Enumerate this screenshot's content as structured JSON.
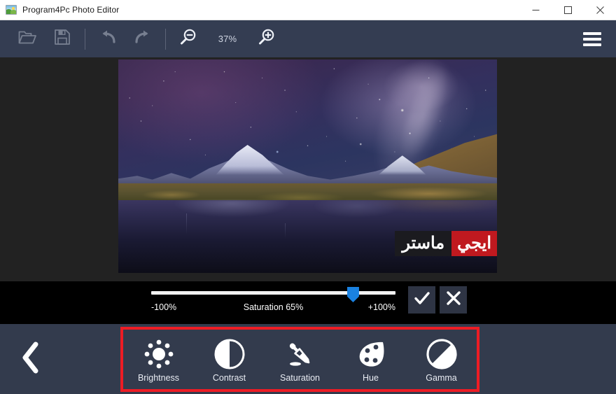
{
  "window": {
    "title": "Program4Pc Photo Editor",
    "app_icon": "photo-icon",
    "minimize": "–",
    "maximize": "☐",
    "close": "×"
  },
  "toolbar": {
    "open_label": "open-file",
    "save_label": "save-file",
    "undo_label": "undo",
    "redo_label": "redo",
    "zoom_out_label": "zoom-out",
    "zoom_in_label": "zoom-in",
    "zoom_level": "37%",
    "menu_label": "main-menu"
  },
  "canvas": {
    "image_alt": "night-sky-mountain-lake-photo",
    "watermark_dark": "ماستر",
    "watermark_red": "ايجي"
  },
  "slider": {
    "min_label": "-100%",
    "max_label": "+100%",
    "name": "Saturation",
    "value_label": "65%",
    "center_label": "Saturation  65%",
    "value": 65,
    "min": -100,
    "max": 100,
    "handle_position_pct": 82.5,
    "accent_color": "#1a82e2",
    "confirm_label": "✓",
    "cancel_label": "✕"
  },
  "bottom": {
    "back_label": "back",
    "highlight_color": "#ed1c24",
    "tools": [
      {
        "id": "brightness",
        "label": "Brightness",
        "icon": "brightness-icon"
      },
      {
        "id": "contrast",
        "label": "Contrast",
        "icon": "contrast-icon"
      },
      {
        "id": "saturation",
        "label": "Saturation",
        "icon": "eyedropper-icon"
      },
      {
        "id": "hue",
        "label": "Hue",
        "icon": "palette-icon"
      },
      {
        "id": "gamma",
        "label": "Gamma",
        "icon": "gamma-icon"
      }
    ]
  },
  "colors": {
    "titlebar_bg": "#ffffff",
    "toolbar_bg": "#343d52",
    "canvas_bg": "#222222",
    "slider_bg": "#000000",
    "bottom_bg": "#333b4d",
    "accent": "#1a82e2",
    "highlight": "#ed1c24"
  }
}
